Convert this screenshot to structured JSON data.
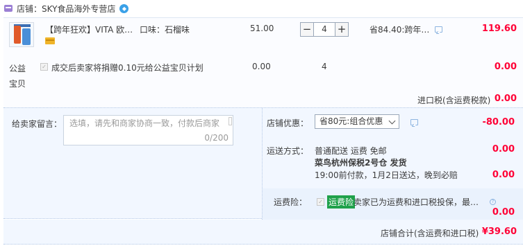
{
  "shop": {
    "label": "店铺：",
    "name": "SKY食品海外专营店",
    "icon": "shop-icon",
    "badge_icon": "verified-badge-icon"
  },
  "item": {
    "title": "【跨年狂欢】VITA 欧…",
    "spec": "口味：石榴味",
    "unit_price": "51.00",
    "quantity": "4",
    "qty_minus": "−",
    "qty_plus": "+",
    "discount_note": "省84.40:跨年…",
    "total": "119.60"
  },
  "charity": {
    "label": "公益宝贝",
    "checkbox": "✓",
    "text": "成交后卖家将捐赠0.10元给公益宝贝计划",
    "unit_price": "0.00",
    "quantity": "4",
    "total": "0.00"
  },
  "import_tax": {
    "label": "进口税(含运费税款)",
    "value": "0.00"
  },
  "memo": {
    "label": "给卖家留言：",
    "placeholder": "选填，请先和商家协商一致，付款后商家",
    "counter": "0/200"
  },
  "shop_discount": {
    "label": "店铺优惠：",
    "selected": "省80元:组合优惠",
    "value": "-80.00"
  },
  "shipping": {
    "label": "运送方式：",
    "line1": "普通配送 运费 免邮",
    "line2": "菜鸟杭州保税2号仓 发货",
    "line3": "19:00前付款，1月2日送达，晚到必赔",
    "value": "0.00",
    "extra_value": "0.00"
  },
  "insurance": {
    "label": "运费险：",
    "checkbox": "✓",
    "tag": "运费险",
    "text": "卖家已为运费和进口税投保，最…",
    "help": "?",
    "value": "0.00"
  },
  "summary": {
    "label": "店铺合计(含运费和进口税)",
    "value": "¥39.60"
  },
  "colors": {
    "price_red": "#ff0036",
    "panel_blue": "#f2f7ff",
    "insurance_green": "#1fa14a"
  }
}
